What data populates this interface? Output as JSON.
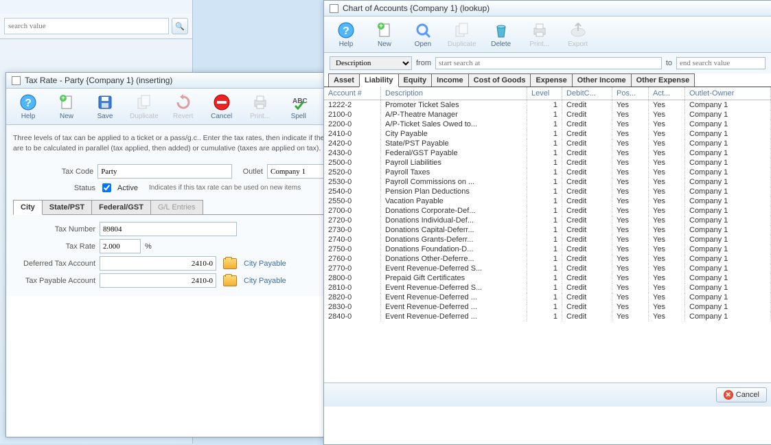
{
  "bg_search_placeholder": "search value",
  "tax_window": {
    "title": "Tax Rate - Party {Company 1} (inserting)",
    "toolbar": [
      "Help",
      "New",
      "Save",
      "Duplicate",
      "Revert",
      "Cancel",
      "Print...",
      "Spell"
    ],
    "hint": "Three levels of tax can be applied to a ticket or a pass/g.c.. Enter the tax rates, then indicate if they are to be calculated in parallel (tax applied, then added) or cumulative (taxes are applied on tax).",
    "tax_code_label": "Tax Code",
    "tax_code": "Party",
    "outlet_label": "Outlet",
    "outlet": "Company 1",
    "status_label": "Status",
    "active_label": "Active",
    "active_hint": "Indicates if this tax rate can be used on new items",
    "tabs": [
      "City",
      "State/PST",
      "Federal/GST",
      "G/L Entries"
    ],
    "tax_number_label": "Tax Number",
    "tax_number": "89804",
    "tax_rate_label": "Tax Rate",
    "tax_rate": "2.000",
    "percent": "%",
    "deferred_label": "Deferred Tax Account",
    "deferred_val": "2410-0",
    "deferred_link": "City Payable",
    "payable_label": "Tax Payable Account",
    "payable_val": "2410-0",
    "payable_link": "City Payable"
  },
  "coa_window": {
    "title": "Chart of Accounts {Company 1} (lookup)",
    "toolbar": [
      "Help",
      "New",
      "Open",
      "Duplicate",
      "Delete",
      "Print...",
      "Export"
    ],
    "desc_label": "Description",
    "from_label": "from",
    "from_placeholder": "start search at",
    "to_label": "to",
    "to_placeholder": "end search value",
    "tabs": [
      "Asset",
      "Liability",
      "Equity",
      "Income",
      "Cost of Goods",
      "Expense",
      "Other Income",
      "Other Expense"
    ],
    "active_tab": "Liability",
    "columns": [
      "Account #",
      "Description",
      "Level",
      "DebitC...",
      "Pos...",
      "Act...",
      "Outlet-Owner"
    ],
    "rows": [
      [
        "1222-2",
        "Promoter Ticket Sales",
        "1",
        "Credit",
        "Yes",
        "Yes",
        "Company 1"
      ],
      [
        "2100-0",
        "A/P-Theatre Manager",
        "1",
        "Credit",
        "Yes",
        "Yes",
        "Company 1"
      ],
      [
        "2200-0",
        "A/P-Ticket Sales Owed to...",
        "1",
        "Credit",
        "Yes",
        "Yes",
        "Company 1"
      ],
      [
        "2410-0",
        "City Payable",
        "1",
        "Credit",
        "Yes",
        "Yes",
        "Company 1"
      ],
      [
        "2420-0",
        "State/PST Payable",
        "1",
        "Credit",
        "Yes",
        "Yes",
        "Company 1"
      ],
      [
        "2430-0",
        "Federal/GST Payable",
        "1",
        "Credit",
        "Yes",
        "Yes",
        "Company 1"
      ],
      [
        "2500-0",
        "Payroll Liabilities",
        "1",
        "Credit",
        "Yes",
        "Yes",
        "Company 1"
      ],
      [
        "2520-0",
        "Payroll Taxes",
        "1",
        "Credit",
        "Yes",
        "Yes",
        "Company 1"
      ],
      [
        "2530-0",
        "Payroll Commissions on ...",
        "1",
        "Credit",
        "Yes",
        "Yes",
        "Company 1"
      ],
      [
        "2540-0",
        "Pension Plan Deductions",
        "1",
        "Credit",
        "Yes",
        "Yes",
        "Company 1"
      ],
      [
        "2550-0",
        "Vacation Payable",
        "1",
        "Credit",
        "Yes",
        "Yes",
        "Company 1"
      ],
      [
        "2700-0",
        "Donations Corporate-Def...",
        "1",
        "Credit",
        "Yes",
        "Yes",
        "Company 1"
      ],
      [
        "2720-0",
        "Donations Individual-Def...",
        "1",
        "Credit",
        "Yes",
        "Yes",
        "Company 1"
      ],
      [
        "2730-0",
        "Donations Capital-Deferr...",
        "1",
        "Credit",
        "Yes",
        "Yes",
        "Company 1"
      ],
      [
        "2740-0",
        "Donations Grants-Deferr...",
        "1",
        "Credit",
        "Yes",
        "Yes",
        "Company 1"
      ],
      [
        "2750-0",
        "Donations Foundation-D...",
        "1",
        "Credit",
        "Yes",
        "Yes",
        "Company 1"
      ],
      [
        "2760-0",
        "Donations Other-Deferre...",
        "1",
        "Credit",
        "Yes",
        "Yes",
        "Company 1"
      ],
      [
        "2770-0",
        "Event Revenue-Deferred S...",
        "1",
        "Credit",
        "Yes",
        "Yes",
        "Company 1"
      ],
      [
        "2800-0",
        "Prepaid Gift Certificates",
        "1",
        "Credit",
        "Yes",
        "Yes",
        "Company 1"
      ],
      [
        "2810-0",
        "Event Revenue-Deferred S...",
        "1",
        "Credit",
        "Yes",
        "Yes",
        "Company 1"
      ],
      [
        "2820-0",
        "Event Revenue-Deferred ...",
        "1",
        "Credit",
        "Yes",
        "Yes",
        "Company 1"
      ],
      [
        "2830-0",
        "Event Revenue-Deferred ...",
        "1",
        "Credit",
        "Yes",
        "Yes",
        "Company 1"
      ],
      [
        "2840-0",
        "Event Revenue-Deferred ...",
        "1",
        "Credit",
        "Yes",
        "Yes",
        "Company 1"
      ]
    ],
    "cancel": "Cancel"
  }
}
